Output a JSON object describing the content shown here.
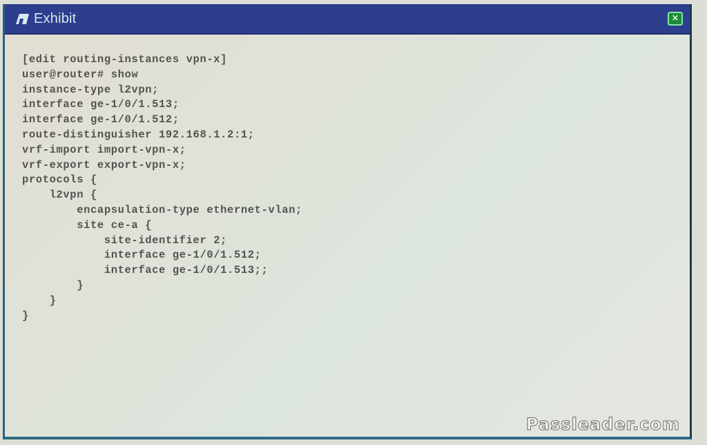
{
  "window": {
    "title": "Exhibit",
    "close_label": "✕"
  },
  "code_lines": [
    "[edit routing-instances vpn-x]",
    "user@router# show",
    "instance-type l2vpn;",
    "interface ge-1/0/1.513;",
    "interface ge-1/0/1.512;",
    "route-distinguisher 192.168.1.2:1;",
    "vrf-import import-vpn-x;",
    "vrf-export export-vpn-x;",
    "protocols {",
    "    l2vpn {",
    "        encapsulation-type ethernet-vlan;",
    "        site ce-a {",
    "            site-identifier 2;",
    "            interface ge-1/0/1.512;",
    "            interface ge-1/0/1.513;;",
    "        }",
    "    }",
    "}"
  ],
  "watermark": "Passleader.com",
  "colors": {
    "titlebar": "#2d3e8f",
    "close_button": "#1f8a3a",
    "text": "#3a3a3a"
  }
}
